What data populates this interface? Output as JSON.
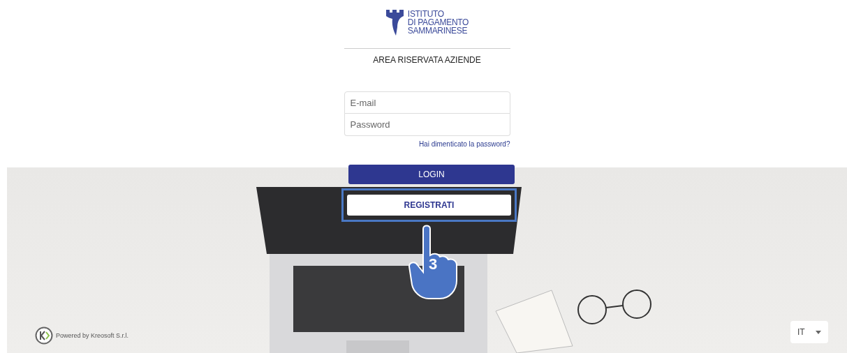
{
  "logo": {
    "lines": [
      "ISTITUTO",
      "DI PAGAMENTO",
      "SAMMARINESE"
    ]
  },
  "title": "AREA RISERVATA AZIENDE",
  "form": {
    "fields": [
      {
        "placeholder": "E-mail"
      },
      {
        "placeholder": "Password"
      }
    ],
    "forgot_link": "Hai dimenticato la password?",
    "login_button": "LOGIN",
    "register_button": {
      "label": "REGISTRATI",
      "highlighted": true
    }
  },
  "step_marker": "3",
  "footer": {
    "powered_by": "Powered by Kreosoft S.r.l.",
    "language": "IT"
  }
}
